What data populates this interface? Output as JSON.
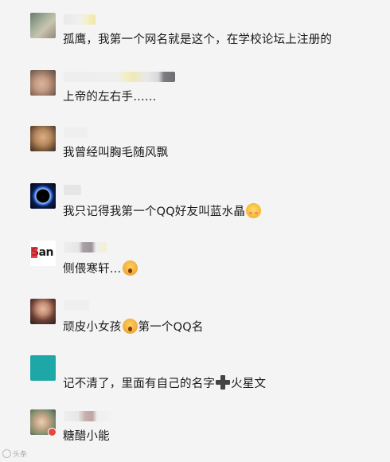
{
  "comments": [
    {
      "text": "孤鹰，我第一个网名就是这个，在学校论坛上注册的"
    },
    {
      "text": "上帝的左右手……"
    },
    {
      "text": "我曾经叫胸毛随风飘"
    },
    {
      "text_before": "我只记得我第一个QQ好友叫蓝水晶",
      "emoji": "blush-emoji"
    },
    {
      "text_before": "侧偎寒轩…",
      "emoji": "surprised-emoji"
    },
    {
      "text_before": "顽皮小女孩",
      "emoji": "surprised-emoji",
      "text_after": "第一个QQ名"
    },
    {
      "text_before": "记不清了，里面有自己的名字",
      "icon": "plus-icon",
      "text_after": "火星文"
    },
    {
      "text": "糖醋小能"
    }
  ],
  "avatars": {
    "san_logo_text": "San"
  },
  "watermark": "头条",
  "colors": {
    "background": "#f4f4f4",
    "text": "#1a1a1a",
    "avatar_teal": "#1ea7a7"
  }
}
